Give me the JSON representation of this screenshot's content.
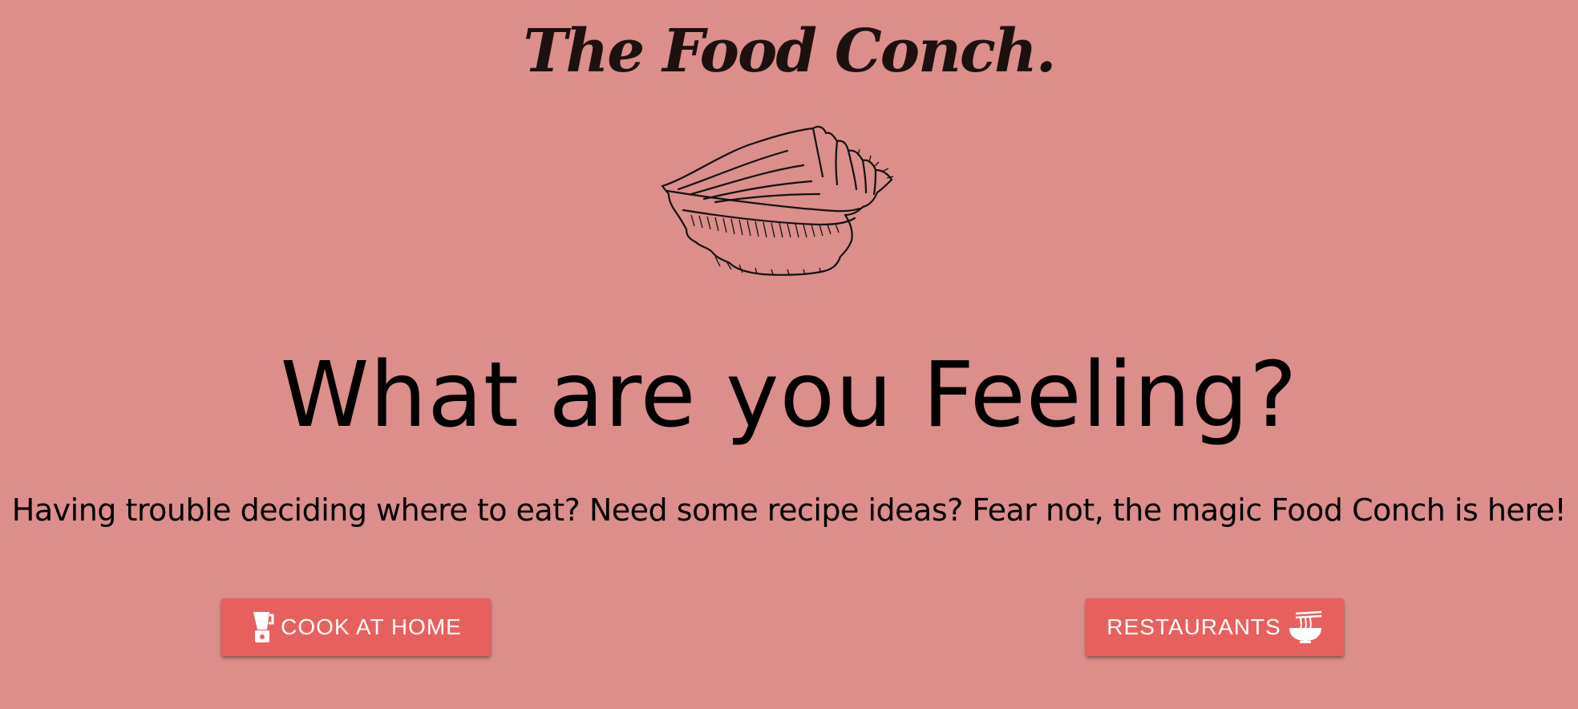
{
  "brand": {
    "title": "The Food Conch."
  },
  "hero": {
    "heading": "What are you Feeling?",
    "subtitle": "Having trouble deciding where to eat? Need some recipe ideas? Fear not, the magic Food Conch is here!"
  },
  "actions": {
    "cook_at_home": {
      "label": "COOK AT HOME",
      "icon": "blender-icon"
    },
    "restaurants": {
      "label": "RESTAURANTS",
      "icon": "noodle-bowl-icon"
    }
  },
  "colors": {
    "background": "#db8e8a",
    "button": "#e8605e",
    "button_text": "#ffffff",
    "brand_text": "#1d1110"
  }
}
